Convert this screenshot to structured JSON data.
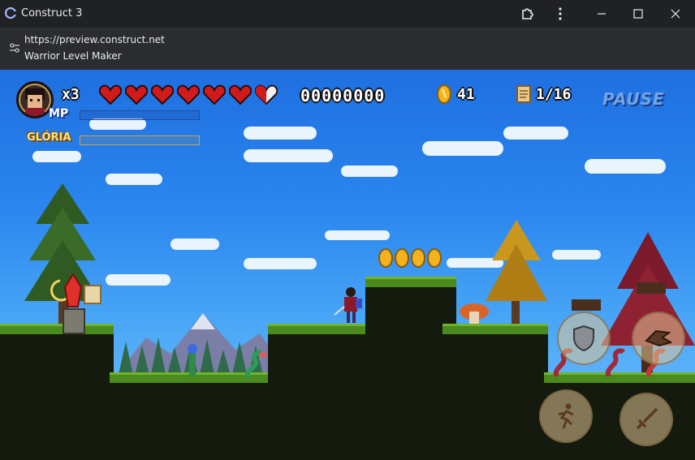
{
  "window": {
    "app_title": "Construct 3",
    "icons": {
      "app": "construct-logo-icon",
      "extension": "puzzle-icon",
      "menu": "more-vert-icon",
      "minimize": "minimize-icon",
      "maximize": "maximize-icon",
      "close": "close-icon"
    }
  },
  "infobar": {
    "url": "https://preview.construct.net",
    "page_title": "Warrior Level Maker",
    "icon": "tune-icon"
  },
  "hud": {
    "lives": "x3",
    "hearts_full": 6,
    "hearts_half": 1,
    "score": "00000000",
    "coins": "41",
    "scrolls": "1/16",
    "mp_label": "MP",
    "gloria_label": "GLÓRIA",
    "pause_label": "PAUSE",
    "mp_fill": 0,
    "gloria_fill": 0
  },
  "colors": {
    "sky_top": "#1f6fe0",
    "grass": "#4b8a1e",
    "heart": "#d11a1a",
    "coin": "#f4b31c"
  },
  "controls": {
    "shield_icon": "shield-icon",
    "dash_icon": "dragon-head-icon",
    "jump_icon": "running-man-icon",
    "attack_icon": "sword-icon"
  }
}
